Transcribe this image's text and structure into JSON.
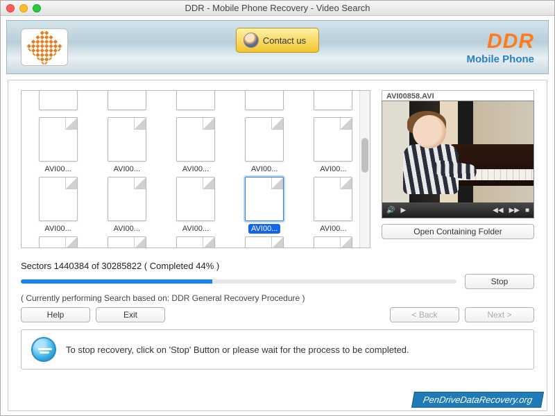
{
  "window": {
    "title": "DDR - Mobile Phone Recovery - Video Search"
  },
  "header": {
    "contact_label": "Contact us",
    "brand_main": "DDR",
    "brand_sub": "Mobile Phone"
  },
  "files": {
    "items": [
      {
        "label": ""
      },
      {
        "label": ""
      },
      {
        "label": ""
      },
      {
        "label": ""
      },
      {
        "label": ""
      },
      {
        "label": "AVI00..."
      },
      {
        "label": "AVI00..."
      },
      {
        "label": "AVI00..."
      },
      {
        "label": "AVI00..."
      },
      {
        "label": "AVI00..."
      },
      {
        "label": "AVI00..."
      },
      {
        "label": "AVI00..."
      },
      {
        "label": "AVI00..."
      },
      {
        "label": "AVI00...",
        "selected": true
      },
      {
        "label": "AVI00..."
      },
      {
        "label": ""
      },
      {
        "label": ""
      },
      {
        "label": ""
      },
      {
        "label": ""
      },
      {
        "label": ""
      }
    ]
  },
  "preview": {
    "filename": "AVI00858.AVI",
    "open_folder_label": "Open Containing Folder"
  },
  "progress": {
    "sectors_text": "Sectors 1440384 of 30285822    ( Completed 44% )",
    "percent": 44,
    "stop_label": "Stop",
    "info_text": "( Currently performing Search based on: DDR General Recovery Procedure )"
  },
  "nav": {
    "help_label": "Help",
    "exit_label": "Exit",
    "back_label": "< Back",
    "next_label": "Next >"
  },
  "hint": {
    "text": "To stop recovery, click on 'Stop' Button or please wait for the process to be completed."
  },
  "watermark": "PenDriveDataRecovery.org"
}
